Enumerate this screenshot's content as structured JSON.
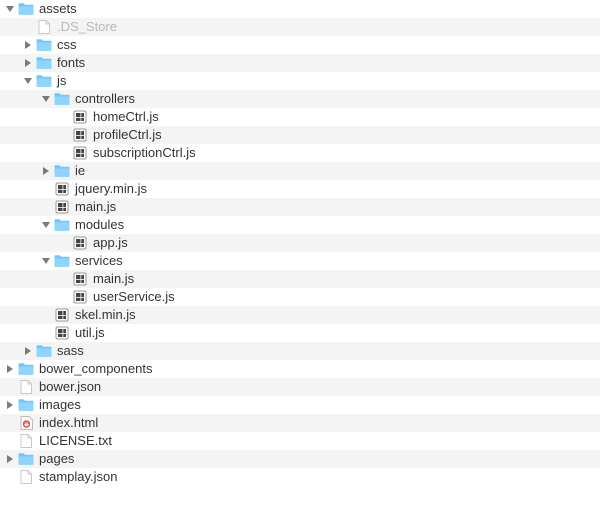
{
  "tree": [
    {
      "depth": 0,
      "arrow": "down",
      "icon": "folder",
      "label": "assets"
    },
    {
      "depth": 1,
      "arrow": "none",
      "icon": "file-blank",
      "label": ".DS_Store",
      "dimmed": true
    },
    {
      "depth": 1,
      "arrow": "right",
      "icon": "folder",
      "label": "css"
    },
    {
      "depth": 1,
      "arrow": "right",
      "icon": "folder",
      "label": "fonts"
    },
    {
      "depth": 1,
      "arrow": "down",
      "icon": "folder",
      "label": "js"
    },
    {
      "depth": 2,
      "arrow": "down",
      "icon": "folder",
      "label": "controllers"
    },
    {
      "depth": 3,
      "arrow": "none",
      "icon": "file-js",
      "label": "homeCtrl.js"
    },
    {
      "depth": 3,
      "arrow": "none",
      "icon": "file-js",
      "label": "profileCtrl.js"
    },
    {
      "depth": 3,
      "arrow": "none",
      "icon": "file-js",
      "label": "subscriptionCtrl.js"
    },
    {
      "depth": 2,
      "arrow": "right",
      "icon": "folder",
      "label": "ie"
    },
    {
      "depth": 2,
      "arrow": "none",
      "icon": "file-js",
      "label": "jquery.min.js"
    },
    {
      "depth": 2,
      "arrow": "none",
      "icon": "file-js",
      "label": "main.js"
    },
    {
      "depth": 2,
      "arrow": "down",
      "icon": "folder",
      "label": "modules"
    },
    {
      "depth": 3,
      "arrow": "none",
      "icon": "file-js",
      "label": "app.js"
    },
    {
      "depth": 2,
      "arrow": "down",
      "icon": "folder",
      "label": "services"
    },
    {
      "depth": 3,
      "arrow": "none",
      "icon": "file-js",
      "label": "main.js"
    },
    {
      "depth": 3,
      "arrow": "none",
      "icon": "file-js",
      "label": "userService.js"
    },
    {
      "depth": 2,
      "arrow": "none",
      "icon": "file-js",
      "label": "skel.min.js"
    },
    {
      "depth": 2,
      "arrow": "none",
      "icon": "file-js",
      "label": "util.js"
    },
    {
      "depth": 1,
      "arrow": "right",
      "icon": "folder",
      "label": "sass"
    },
    {
      "depth": 0,
      "arrow": "right",
      "icon": "folder",
      "label": "bower_components"
    },
    {
      "depth": 0,
      "arrow": "none",
      "icon": "file-blank",
      "label": "bower.json"
    },
    {
      "depth": 0,
      "arrow": "right",
      "icon": "folder",
      "label": "images"
    },
    {
      "depth": 0,
      "arrow": "none",
      "icon": "file-html",
      "label": "index.html"
    },
    {
      "depth": 0,
      "arrow": "none",
      "icon": "file-blank",
      "label": "LICENSE.txt"
    },
    {
      "depth": 0,
      "arrow": "right",
      "icon": "folder",
      "label": "pages"
    },
    {
      "depth": 0,
      "arrow": "none",
      "icon": "file-blank",
      "label": "stamplay.json"
    }
  ],
  "indentWidth": 18
}
